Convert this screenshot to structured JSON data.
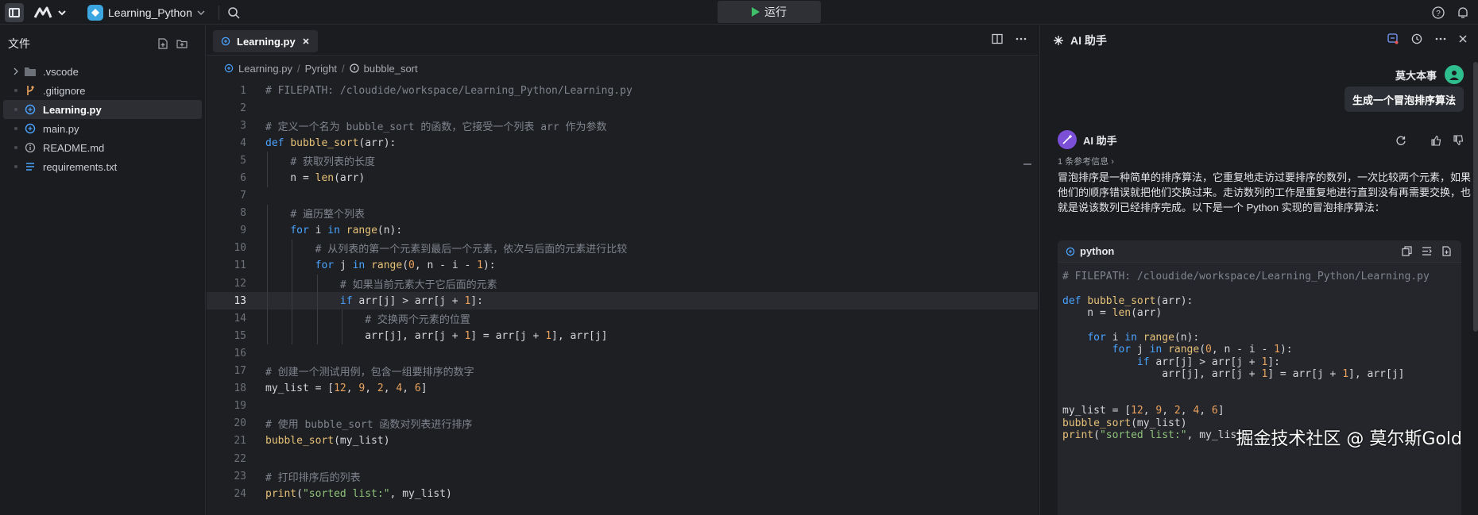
{
  "topbar": {
    "project_name": "Learning_Python",
    "run_label": "运行"
  },
  "sidebar": {
    "title": "文件",
    "items": [
      {
        "label": ".vscode",
        "kind": "folder"
      },
      {
        "label": ".gitignore",
        "kind": "git"
      },
      {
        "label": "Learning.py",
        "kind": "python",
        "active": true
      },
      {
        "label": "main.py",
        "kind": "python"
      },
      {
        "label": "README.md",
        "kind": "info"
      },
      {
        "label": "requirements.txt",
        "kind": "text"
      }
    ]
  },
  "editor": {
    "tab_label": "Learning.py",
    "breadcrumb": [
      "Learning.py",
      "Pyright",
      "bubble_sort"
    ],
    "current_line": 13
  },
  "code_lines": [
    "# FILEPATH: /cloudide/workspace/Learning_Python/Learning.py",
    "",
    "# 定义一个名为 bubble_sort 的函数，它接受一个列表 arr 作为参数",
    "def bubble_sort(arr):",
    "    # 获取列表的长度",
    "    n = len(arr)",
    "",
    "    # 遍历整个列表",
    "    for i in range(n):",
    "        # 从列表的第一个元素到最后一个元素，依次与后面的元素进行比较",
    "        for j in range(0, n - i - 1):",
    "            # 如果当前元素大于它后面的元素",
    "            if arr[j] > arr[j + 1]:",
    "                # 交换两个元素的位置",
    "                arr[j], arr[j + 1] = arr[j + 1], arr[j]",
    "",
    "# 创建一个测试用例，包含一组要排序的数字",
    "my_list = [12, 9, 2, 4, 6]",
    "",
    "# 使用 bubble_sort 函数对列表进行排序",
    "bubble_sort(my_list)",
    "",
    "# 打印排序后的列表",
    "print(\"sorted list:\", my_list)"
  ],
  "ai_panel": {
    "title": "AI 助手",
    "user_name": "莫大本事",
    "user_message": "生成一个冒泡排序算法",
    "bot_name": "AI 助手",
    "references": "1 条参考信息 ›",
    "answer": "冒泡排序是一种简单的排序算法，它重复地走访过要排序的数列，一次比较两个元素，如果他们的顺序错误就把他们交换过来。走访数列的工作是重复地进行直到没有再需要交换，也就是说该数列已经排序完成。以下是一个 Python 实现的冒泡排序算法：",
    "code_language": "python",
    "code_lines": [
      "# FILEPATH: /cloudide/workspace/Learning_Python/Learning.py",
      "",
      "def bubble_sort(arr):",
      "    n = len(arr)",
      "",
      "    for i in range(n):",
      "        for j in range(0, n - i - 1):",
      "            if arr[j] > arr[j + 1]:",
      "                arr[j], arr[j + 1] = arr[j + 1], arr[j]",
      "",
      "",
      "my_list = [12, 9, 2, 4, 6]",
      "bubble_sort(my_list)",
      "print(\"sorted list:\", my_list)"
    ],
    "watermark": "掘金技术社区 @ 莫尔斯Gold"
  },
  "colors": {
    "accent_run": "#3fbf6a",
    "keyword": "#4aa3ff",
    "function": "#e6c178",
    "number": "#e9a25e",
    "string": "#8fc27a",
    "comment": "#7f848e"
  }
}
